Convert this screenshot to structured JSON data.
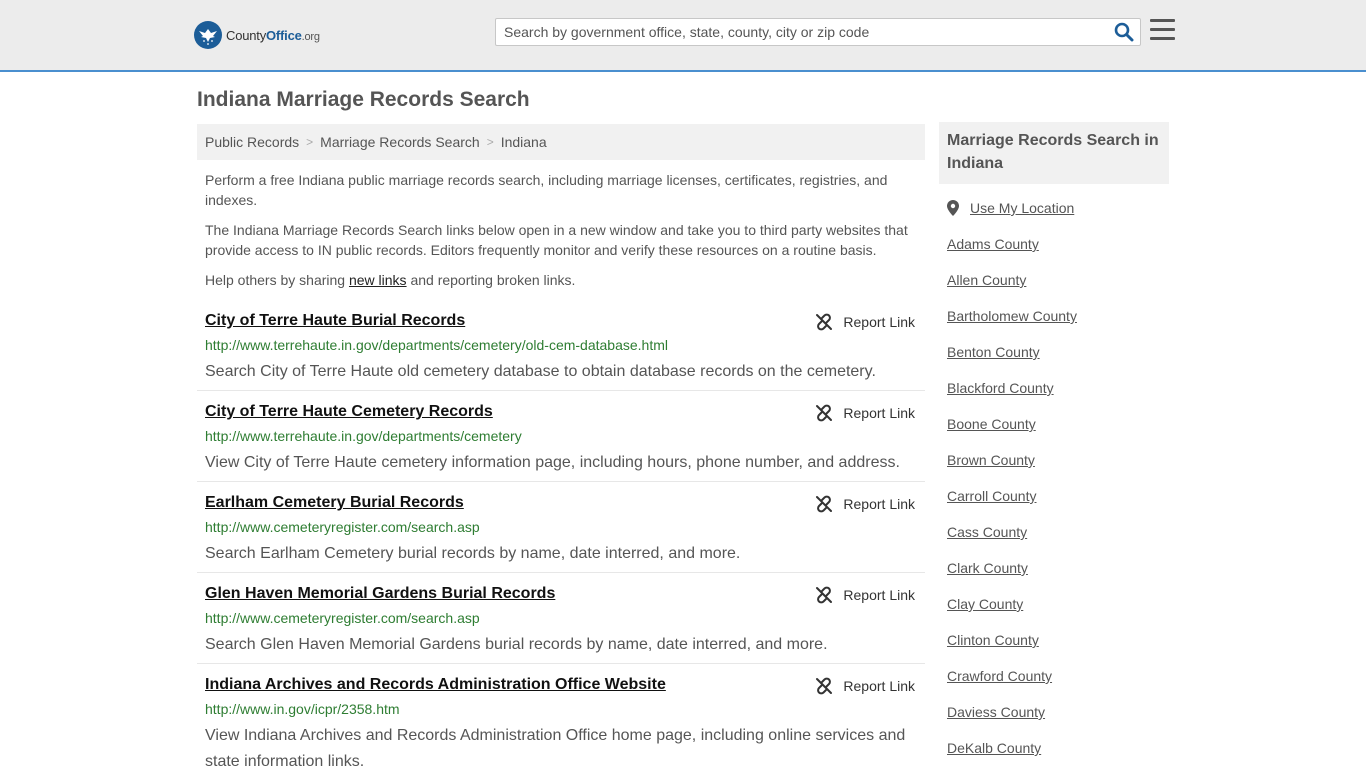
{
  "header": {
    "logo": {
      "part1": "County",
      "part2": "Office",
      "part3": ".org"
    },
    "search": {
      "placeholder": "Search by government office, state, county, city or zip code"
    },
    "icons": {
      "search": "search-icon",
      "menu": "hamburger-menu-icon"
    }
  },
  "main": {
    "title": "Indiana Marriage Records Search",
    "breadcrumb": [
      "Public Records",
      "Marriage Records Search",
      "Indiana"
    ],
    "intro": {
      "p1": "Perform a free Indiana public marriage records search, including marriage licenses, certificates, registries, and indexes.",
      "p2": "The Indiana Marriage Records Search links below open in a new window and take you to third party websites that provide access to IN public records. Editors frequently monitor and verify these resources on a routine basis.",
      "p3_before": "Help others by sharing ",
      "p3_link": "new links",
      "p3_after": " and reporting broken links."
    },
    "report_label": "Report Link",
    "results": [
      {
        "title": "City of Terre Haute Burial Records",
        "url": "http://www.terrehaute.in.gov/departments/cemetery/old-cem-database.html",
        "desc": "Search City of Terre Haute old cemetery database to obtain database records on the cemetery."
      },
      {
        "title": "City of Terre Haute Cemetery Records",
        "url": "http://www.terrehaute.in.gov/departments/cemetery",
        "desc": "View City of Terre Haute cemetery information page, including hours, phone number, and address."
      },
      {
        "title": "Earlham Cemetery Burial Records",
        "url": "http://www.cemeteryregister.com/search.asp",
        "desc": "Search Earlham Cemetery burial records by name, date interred, and more."
      },
      {
        "title": "Glen Haven Memorial Gardens Burial Records",
        "url": "http://www.cemeteryregister.com/search.asp",
        "desc": "Search Glen Haven Memorial Gardens burial records by name, date interred, and more."
      },
      {
        "title": "Indiana Archives and Records Administration Office Website",
        "url": "http://www.in.gov/icpr/2358.htm",
        "desc": "View Indiana Archives and Records Administration Office home page, including online services and state information links."
      }
    ]
  },
  "sidebar": {
    "title": "Marriage Records Search in Indiana",
    "location_label": "Use My Location",
    "counties": [
      "Adams County",
      "Allen County",
      "Bartholomew County",
      "Benton County",
      "Blackford County",
      "Boone County",
      "Brown County",
      "Carroll County",
      "Cass County",
      "Clark County",
      "Clay County",
      "Clinton County",
      "Crawford County",
      "Daviess County",
      "DeKalb County"
    ]
  },
  "colors": {
    "accent": "#1c5d98",
    "url_green": "#2e7d32",
    "header_bg": "#ececec",
    "header_border": "#4a8fcf"
  }
}
